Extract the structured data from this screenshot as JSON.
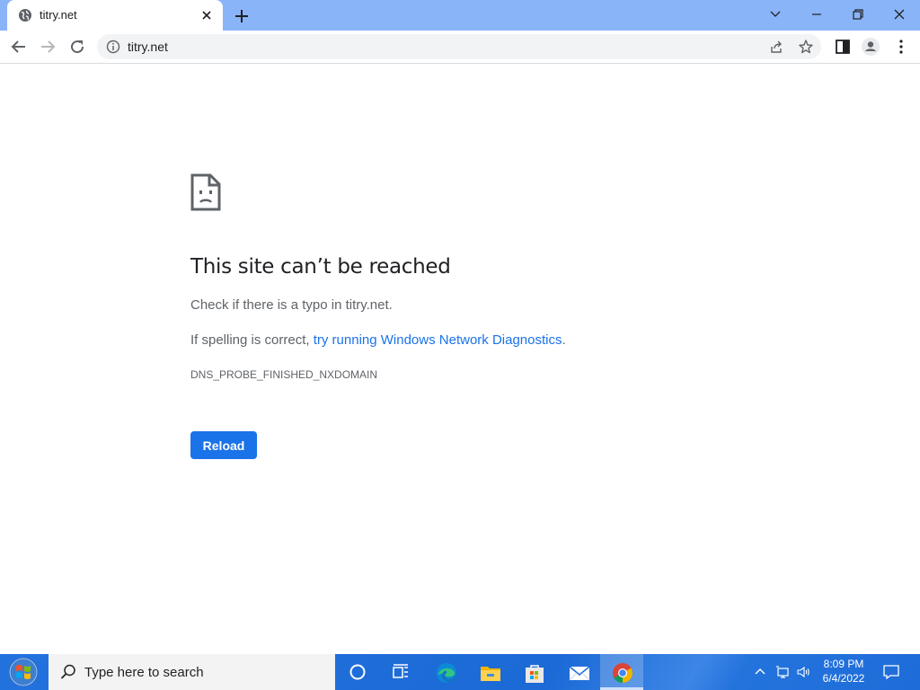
{
  "browser": {
    "tab": {
      "title": "titry.net"
    },
    "omnibox": {
      "url": "titry.net"
    }
  },
  "error_page": {
    "heading": "This site can’t be reached",
    "line1": "Check if there is a typo in titry.net.",
    "line2_prefix": "If spelling is correct, ",
    "line2_link": "try running Windows Network Diagnostics",
    "line2_suffix": ".",
    "error_code": "DNS_PROBE_FINISHED_NXDOMAIN",
    "reload_label": "Reload"
  },
  "taskbar": {
    "search_placeholder": "Type here to search",
    "time": "8:09 PM",
    "date": "6/4/2022"
  },
  "colors": {
    "accent": "#1a73e8",
    "tab_strip": "#8ab4f8",
    "taskbar": "#1f6fd9"
  },
  "icons": [
    "globe-icon",
    "close-icon",
    "plus-icon",
    "chevron-down-icon",
    "minimize-icon",
    "restore-icon",
    "back-icon",
    "forward-icon",
    "reload-icon",
    "info-icon",
    "share-icon",
    "star-icon",
    "side-panel-icon",
    "profile-icon",
    "more-vert-icon",
    "sad-page-icon",
    "windows-logo-icon",
    "search-icon",
    "cortana-icon",
    "task-view-icon",
    "edge-icon",
    "file-explorer-icon",
    "store-icon",
    "mail-icon",
    "chrome-icon",
    "tray-chevron-icon",
    "network-icon",
    "volume-icon",
    "notification-icon"
  ]
}
